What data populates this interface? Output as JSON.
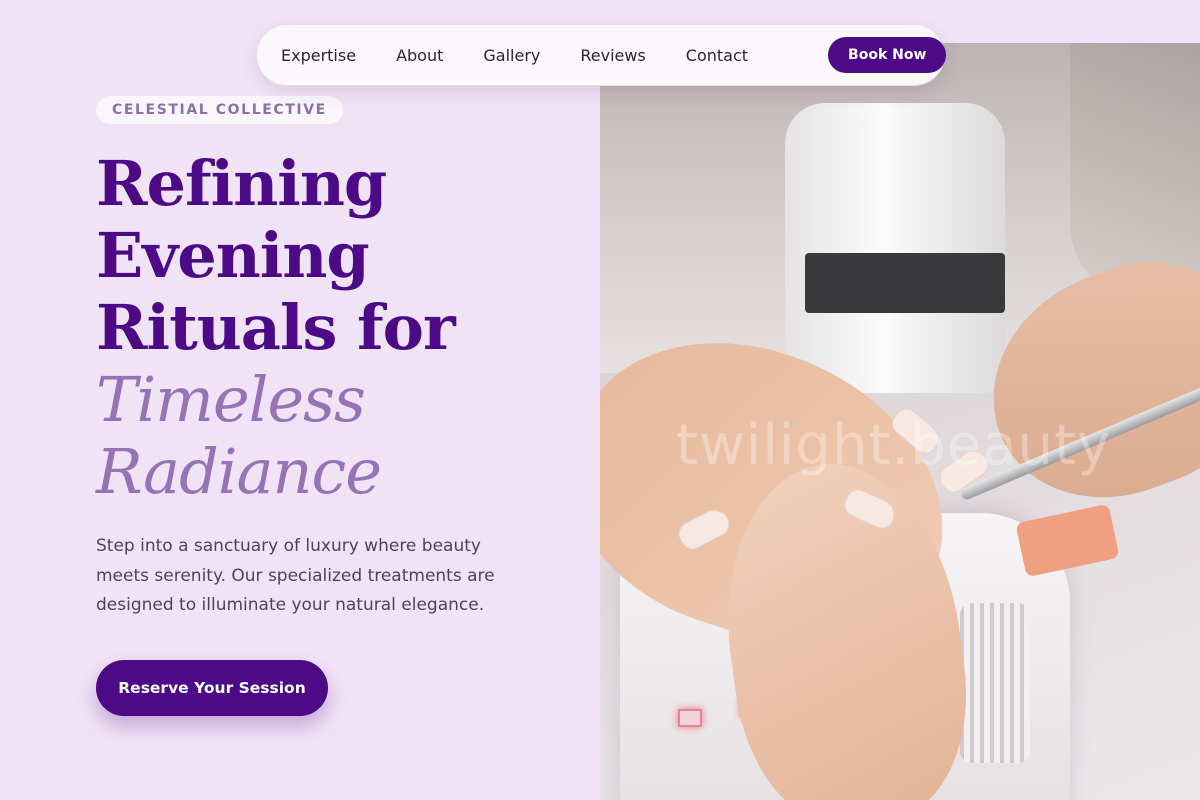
{
  "nav": {
    "links": [
      "Expertise",
      "About",
      "Gallery",
      "Reviews",
      "Contact"
    ],
    "book_label": "Book Now"
  },
  "hero": {
    "badge": "CELESTIAL COLLECTIVE",
    "headline_lines": [
      "Refining",
      "Evening",
      "Rituals for"
    ],
    "headline_accent_lines": [
      "Timeless",
      "Radiance"
    ],
    "description": "Step into a sanctuary of luxury where beauty meets serenity. Our specialized treatments are designed to illuminate your natural elegance.",
    "cta_label": "Reserve Your Session",
    "image_watermark": "twilight.beauty"
  },
  "colors": {
    "background": "#f1e3f6",
    "primary": "#4c0a86",
    "accent": "#9673b5",
    "badge_text": "#8d70a8",
    "body_text": "#4b4552"
  }
}
